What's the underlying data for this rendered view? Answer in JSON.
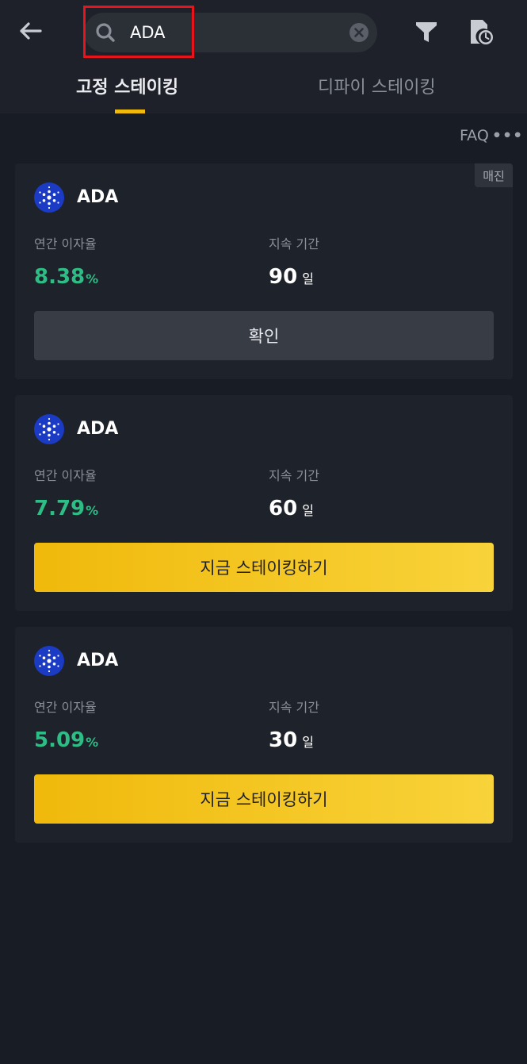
{
  "search": {
    "value": "ADA",
    "placeholder": ""
  },
  "tabs": [
    {
      "label": "고정 스테이킹",
      "active": true
    },
    {
      "label": "디파이 스테이킹",
      "active": false
    }
  ],
  "faq": {
    "label": "FAQ",
    "dots": "•••"
  },
  "colors": {
    "accent": "#f0b90b",
    "apr_green": "#2ebd85",
    "highlight_red": "#e8141b",
    "background": "#181c24",
    "card": "#1e222a"
  },
  "cards": [
    {
      "coin": "ADA",
      "badge": "매진",
      "apr_label": "연간 이자율",
      "apr": "8.38",
      "apr_unit": "%",
      "duration_label": "지속 기간",
      "duration": "90",
      "duration_unit": "일",
      "button": "확인"
    },
    {
      "coin": "ADA",
      "apr_label": "연간 이자율",
      "apr": "7.79",
      "apr_unit": "%",
      "duration_label": "지속 기간",
      "duration": "60",
      "duration_unit": "일",
      "button": "지금 스테이킹하기"
    },
    {
      "coin": "ADA",
      "apr_label": "연간 이자율",
      "apr": "5.09",
      "apr_unit": "%",
      "duration_label": "지속 기간",
      "duration": "30",
      "duration_unit": "일",
      "button": "지금 스테이킹하기"
    }
  ],
  "icons": {
    "back": "arrow-left-icon",
    "search": "search-icon",
    "clear": "clear-circle-icon",
    "filter": "filter-funnel-icon",
    "history": "history-document-clock-icon",
    "coin": "cardano-logo-icon"
  }
}
